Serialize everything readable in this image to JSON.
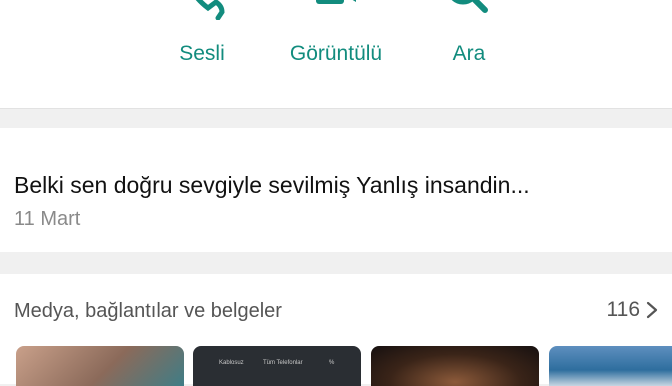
{
  "actions": {
    "voice_label": "Sesli",
    "video_label": "Görüntülü",
    "search_label": "Ara"
  },
  "status": {
    "text": "Belki sen doğru sevgiyle sevilmiş Yanlış insandin...",
    "date": "11 Mart"
  },
  "media": {
    "title": "Medya, bağlantılar ve belgeler",
    "count": "116",
    "thumbnails": [
      {
        "kind": "photo"
      },
      {
        "kind": "screenshot",
        "labels": [
          "Kablosuz",
          "Tüm Telefonlar",
          "%"
        ]
      },
      {
        "kind": "photo"
      },
      {
        "kind": "photo"
      }
    ]
  },
  "colors": {
    "accent": "#128c7e",
    "background": "#f0f0f0",
    "card": "#ffffff"
  }
}
